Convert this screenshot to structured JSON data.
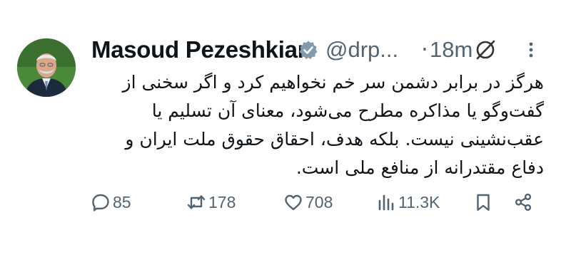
{
  "author": {
    "name": "Masoud Pezeshkian",
    "handle": "@drp...",
    "separator": "·",
    "time": "18m"
  },
  "tweet": {
    "lines": [
      "هرگز در برابر دشمن سر خم نخواهیم کرد و اگر سخنی از",
      "گفت‌وگو یا مذاکره مطرح می‌شود، معنای آن تسلیم یا",
      "عقب‌نشینی نیست. بلکه هدف، احقاق حقوق ملت ایران و",
      "دفاع مقتدرانه از منافع ملی است."
    ]
  },
  "actions": {
    "replies": "85",
    "reposts": "178",
    "likes": "708",
    "views": "11.3K"
  },
  "icons": {
    "verified": "verified-badge-icon",
    "grok": "grok-icon",
    "more": "more-options-icon",
    "reply": "reply-icon",
    "repost": "repost-icon",
    "like": "heart-icon",
    "views": "views-chart-icon",
    "bookmark": "bookmark-icon",
    "share": "share-icon"
  },
  "colors": {
    "text": "#0f1419",
    "secondary": "#536471",
    "verified": "#829aab"
  }
}
